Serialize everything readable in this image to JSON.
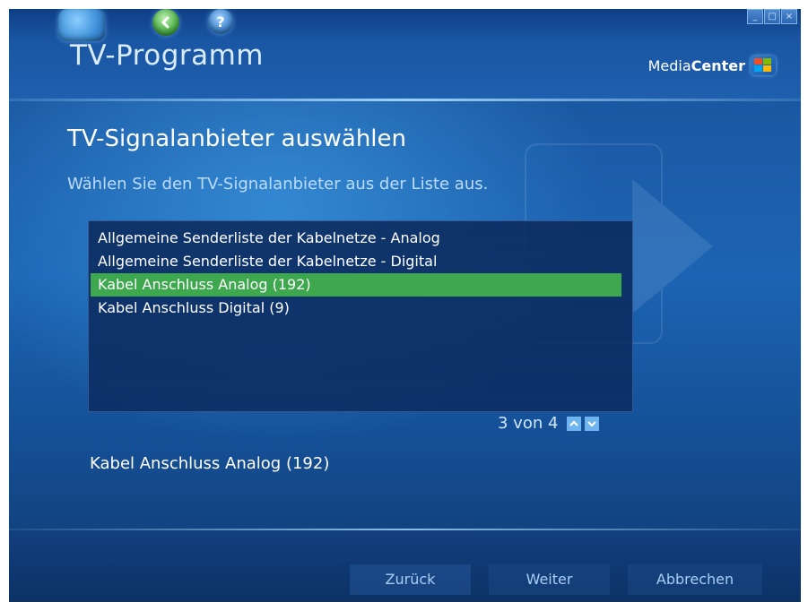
{
  "app": {
    "title": "TV-Programm",
    "brand_prefix": "Media",
    "brand_bold": "Center",
    "accent_color": "#3ea84f"
  },
  "nav": {
    "start_icon": "windows-start-icon",
    "back_icon": "back-arrow-icon",
    "help_icon": "help-icon",
    "help_glyph": "?"
  },
  "window_controls": {
    "minimize": "_",
    "maximize": "□",
    "close": "×"
  },
  "page": {
    "title": "TV-Signalanbieter auswählen",
    "instruction": "Wählen Sie den TV-Signalanbieter aus der Liste aus."
  },
  "list": {
    "items": [
      "Allgemeine Senderliste der Kabelnetze - Analog",
      "Allgemeine Senderliste der Kabelnetze - Digital",
      "Kabel Anschluss Analog (192)",
      "Kabel Anschluss Digital (9)"
    ],
    "selected_index": 2
  },
  "pager": {
    "text": "3 von 4"
  },
  "selection_display": "Kabel Anschluss Analog (192)",
  "footer": {
    "back_label": "Zurück",
    "next_label": "Weiter",
    "cancel_label": "Abbrechen"
  }
}
